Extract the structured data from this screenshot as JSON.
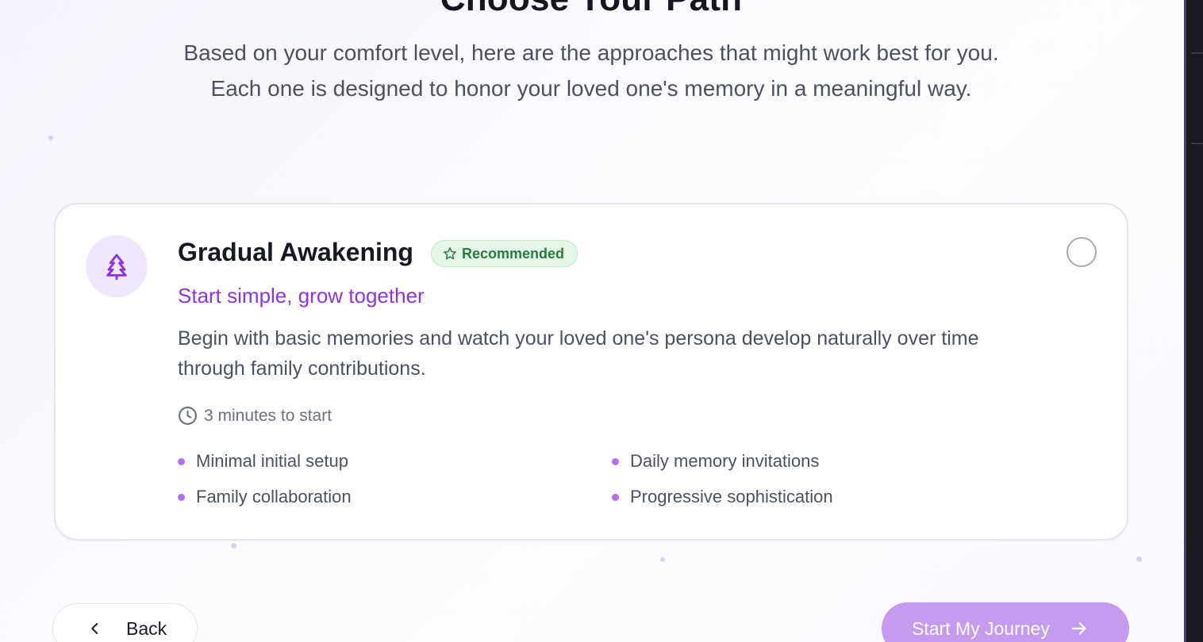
{
  "page": {
    "heading": "Choose Your Path",
    "subtitle": "Based on your comfort level, here are the approaches that might work best for you. Each one is designed to honor your loved one's memory in a meaningful way."
  },
  "option": {
    "icon": "tree-icon",
    "title": "Gradual Awakening",
    "badge": "Recommended",
    "badge_icon": "star-icon",
    "tagline": "Start simple, grow together",
    "description": "Begin with basic memories and watch your loved one's persona develop naturally over time through family contributions.",
    "time": "3 minutes to start",
    "time_icon": "clock-icon",
    "selected": false,
    "features": [
      "Minimal initial setup",
      "Daily memory invitations",
      "Family collaboration",
      "Progressive sophistication"
    ]
  },
  "nav": {
    "back_label": "Back",
    "start_label": "Start My Journey"
  },
  "colors": {
    "accent": "#8a35e0",
    "badge_bg": "#e4f6e8",
    "badge_text": "#2d7a3f",
    "bullet": "#b370ec",
    "primary_button": "#c59af0"
  }
}
